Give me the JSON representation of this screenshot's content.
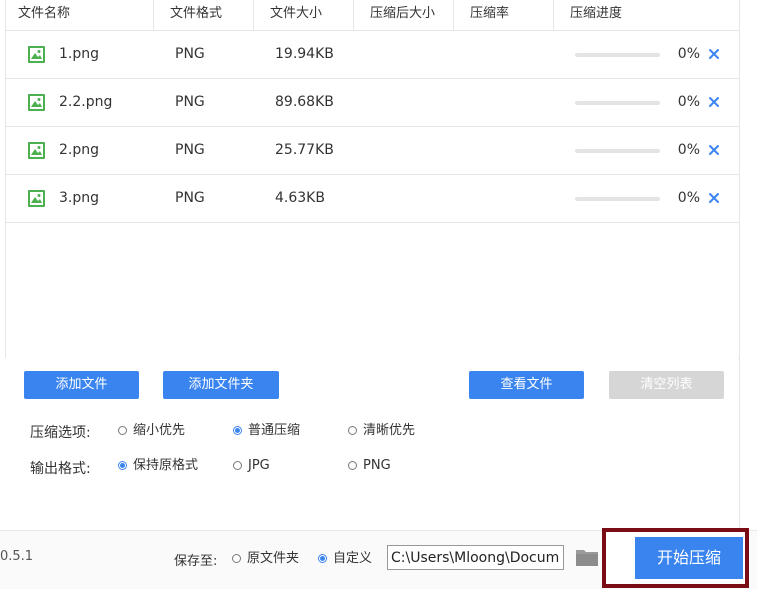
{
  "table": {
    "headers": [
      "文件名称",
      "文件格式",
      "文件大小",
      "压缩后大小",
      "压缩率",
      "压缩进度"
    ],
    "rows": [
      {
        "name": "1.png",
        "format": "PNG",
        "size": "19.94KB",
        "compressed_size": "",
        "ratio": "",
        "progress": 0,
        "progress_label": "0%"
      },
      {
        "name": "2.2.png",
        "format": "PNG",
        "size": "89.68KB",
        "compressed_size": "",
        "ratio": "",
        "progress": 0,
        "progress_label": "0%"
      },
      {
        "name": "2.png",
        "format": "PNG",
        "size": "25.77KB",
        "compressed_size": "",
        "ratio": "",
        "progress": 0,
        "progress_label": "0%"
      },
      {
        "name": "3.png",
        "format": "PNG",
        "size": "4.63KB",
        "compressed_size": "",
        "ratio": "",
        "progress": 0,
        "progress_label": "0%"
      }
    ]
  },
  "buttons": {
    "add_file": "添加文件",
    "add_folder": "添加文件夹",
    "view_file": "查看文件",
    "clear_list": "清空列表",
    "start": "开始压缩"
  },
  "compression": {
    "label": "压缩选项:",
    "options": [
      "缩小优先",
      "普通压缩",
      "清晰优先"
    ],
    "selected": "普通压缩"
  },
  "output_format": {
    "label": "输出格式:",
    "options": [
      "保持原格式",
      "JPG",
      "PNG"
    ],
    "selected": "保持原格式"
  },
  "footer": {
    "version": "0.5.1",
    "save_to_label": "保存至:",
    "save_options": [
      "原文件夹",
      "自定义"
    ],
    "save_selected": "自定义",
    "path": "C:\\Users\\Mloong\\Documents"
  },
  "colors": {
    "accent": "#3a84ef",
    "disabled": "#d6d6d6",
    "highlight_frame": "#7a0c16",
    "file_icon": "#4caf50"
  },
  "icons": {
    "file": "image-file-icon",
    "remove": "close-icon",
    "folder": "folder-icon"
  }
}
